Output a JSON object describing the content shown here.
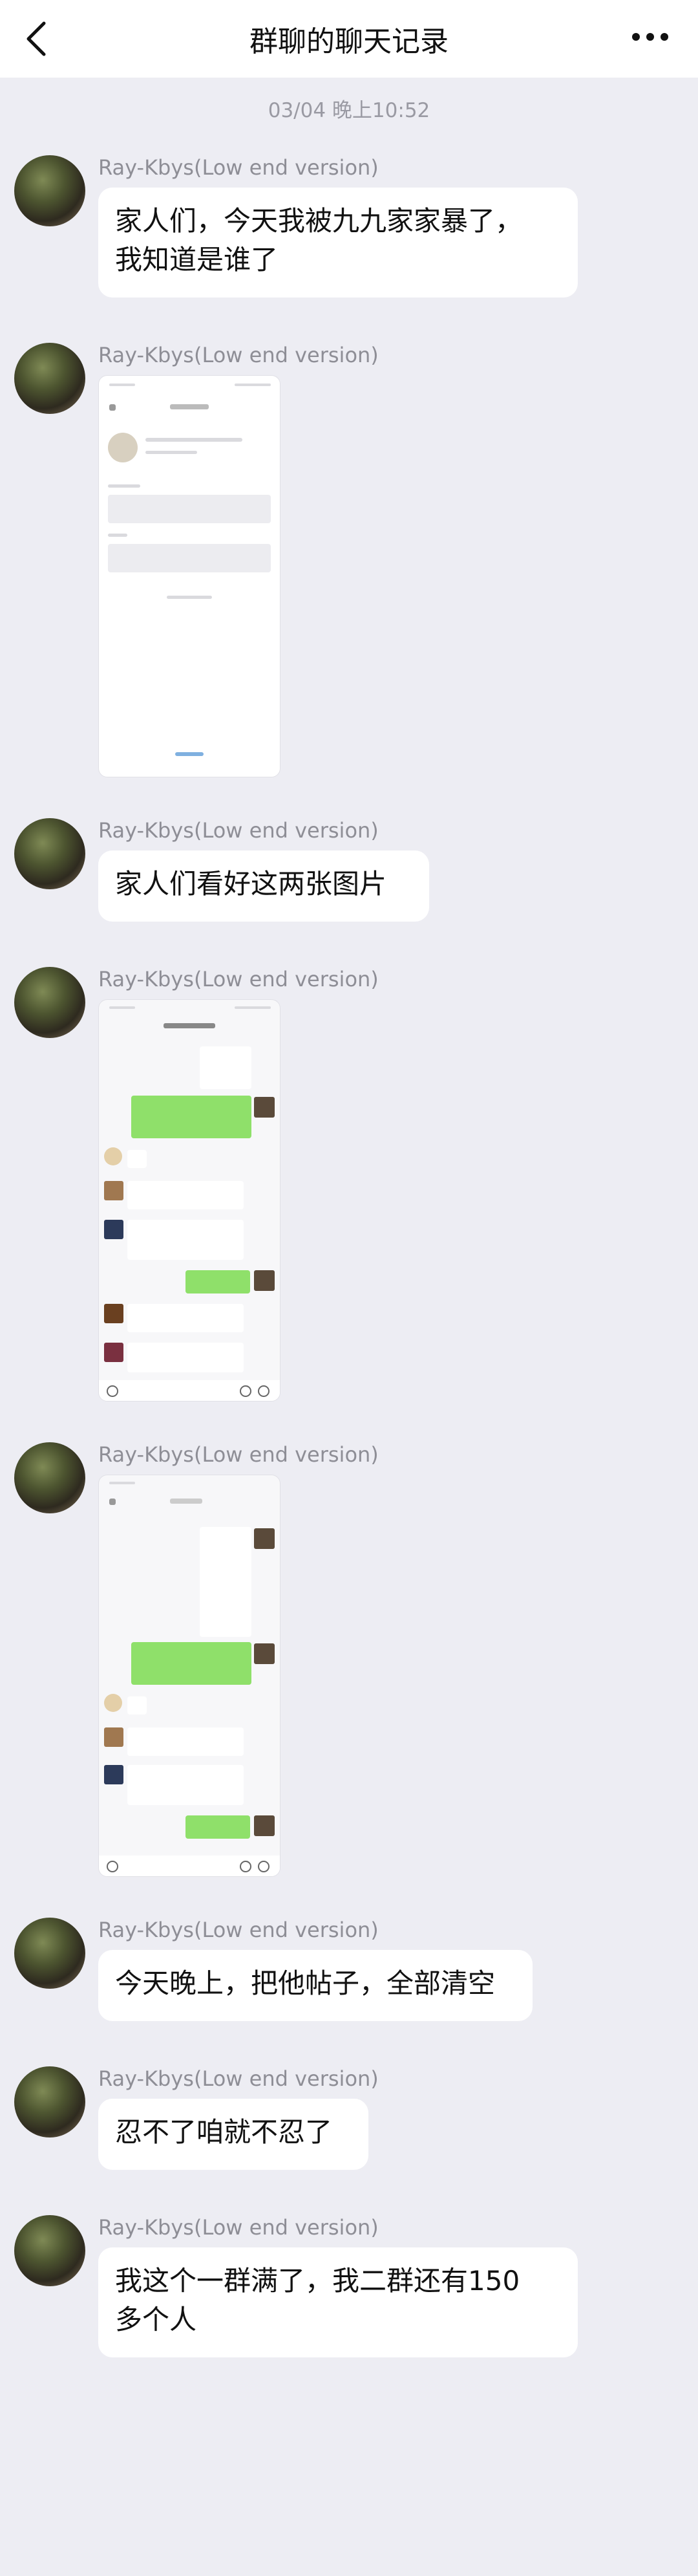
{
  "header": {
    "title": "群聊的聊天记录"
  },
  "timestamp": "03/04 晚上10:52",
  "messages": [
    {
      "sender": "Ray-Kbys(Low end version)",
      "type": "text",
      "text_lines": [
        "家人们，今天我被九九家家暴了，",
        "我知道是谁了"
      ]
    },
    {
      "sender": "Ray-Kbys(Low end version)",
      "type": "image",
      "image_desc": "report-screenshot"
    },
    {
      "sender": "Ray-Kbys(Low end version)",
      "type": "text",
      "text_lines": [
        "家人们看好这两张图片"
      ]
    },
    {
      "sender": "Ray-Kbys(Low end version)",
      "type": "image",
      "image_desc": "chat-screenshot-1"
    },
    {
      "sender": "Ray-Kbys(Low end version)",
      "type": "image",
      "image_desc": "chat-screenshot-2"
    },
    {
      "sender": "Ray-Kbys(Low end version)",
      "type": "text",
      "text_lines": [
        "今天晚上，把他帖子，全部清空"
      ]
    },
    {
      "sender": "Ray-Kbys(Low end version)",
      "type": "text",
      "text_lines": [
        "忍不了咱就不忍了"
      ]
    },
    {
      "sender": "Ray-Kbys(Low end version)",
      "type": "text",
      "text_lines": [
        "我这个一群满了，我二群还有150",
        "多个人"
      ]
    }
  ],
  "icons": {
    "back": "chevron-left-icon",
    "more": "more-dots-icon"
  }
}
